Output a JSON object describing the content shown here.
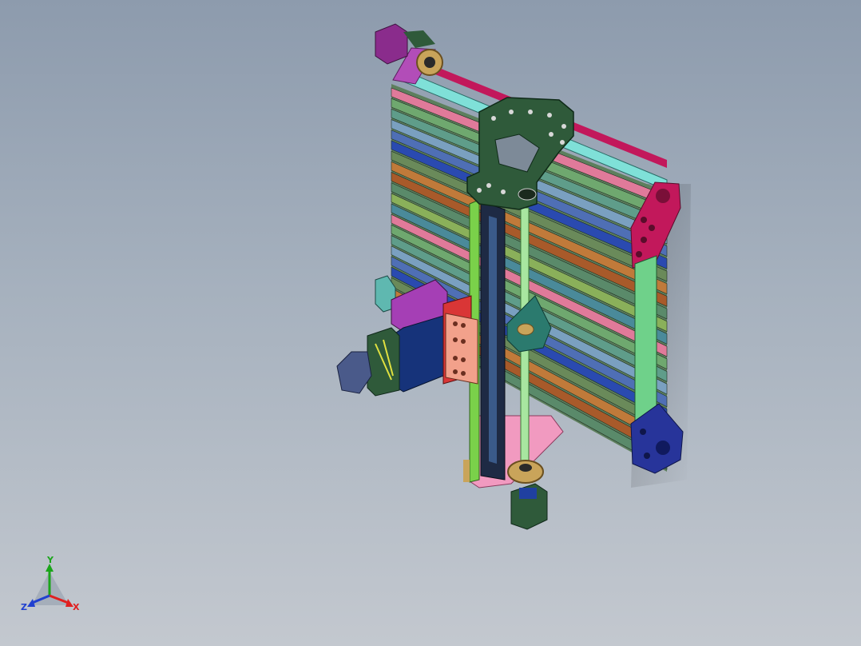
{
  "viewport": {
    "background_top": "#8d9bad",
    "background_bottom": "#c3c8cf"
  },
  "model": {
    "part_colors": {
      "carriage_plate": "#2f5a3a",
      "side_plate_top": "#c2185b",
      "side_plate_bottom": "#27349a",
      "top_shaft": "#c2185b",
      "top_rail": "#7fe0d8",
      "motor_top": "#8a2c8c",
      "motor_left": "#3b4a7a",
      "motor_bottom": "#2f5a3a",
      "z_base_plate": "#f19ac0",
      "z_leadscrew": "#a8e6a0",
      "z_rail_left": "#7ad14a",
      "spindle_block": "#d93636",
      "bearing": "#c9a45a"
    }
  },
  "triad": {
    "x_label": "X",
    "y_label": "Y",
    "z_label": "Z",
    "x_color": "#e02020",
    "y_color": "#1aa51a",
    "z_color": "#2040d0"
  }
}
